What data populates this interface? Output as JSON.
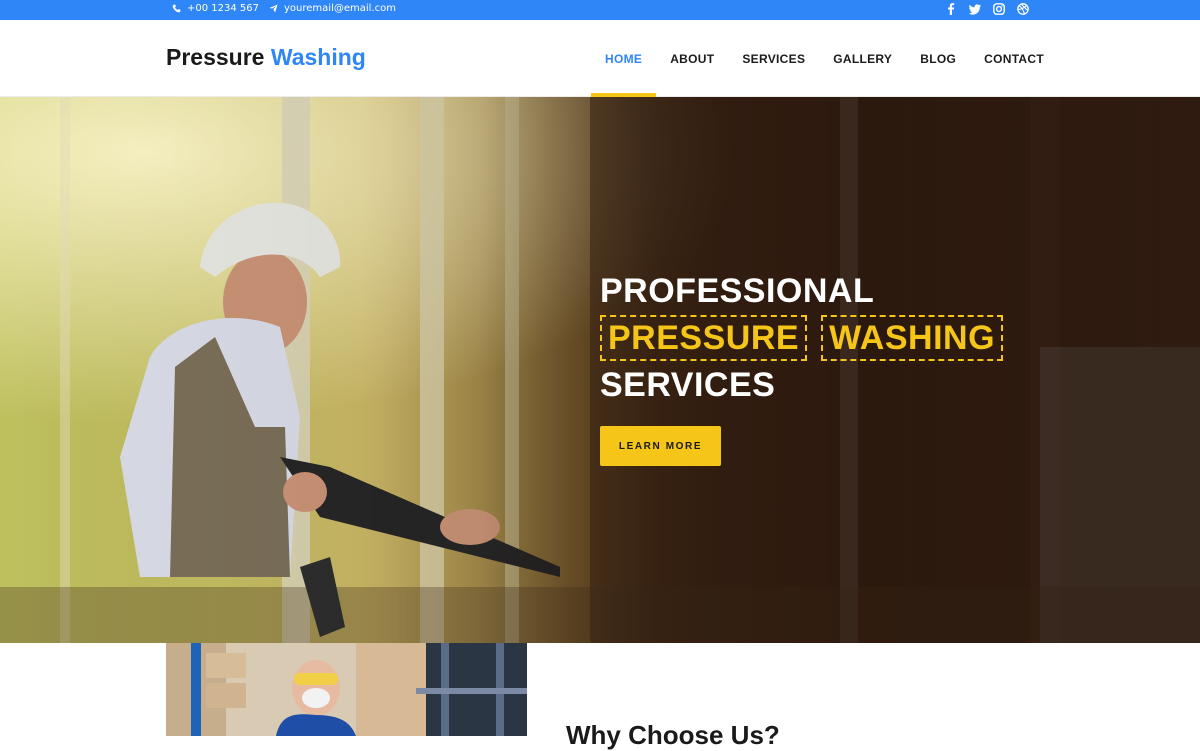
{
  "topbar": {
    "phone": "+00 1234 567",
    "email": "youremail@email.com",
    "icons": [
      "phone-icon",
      "paper-plane-icon"
    ],
    "social": [
      "facebook-icon",
      "twitter-icon",
      "instagram-icon",
      "dribbble-icon"
    ]
  },
  "brand": {
    "part1": "Pressure",
    "part2": "Washing"
  },
  "nav": {
    "items": [
      {
        "label": "HOME",
        "active": true
      },
      {
        "label": "ABOUT",
        "active": false
      },
      {
        "label": "SERVICES",
        "active": false
      },
      {
        "label": "GALLERY",
        "active": false
      },
      {
        "label": "BLOG",
        "active": false
      },
      {
        "label": "CONTACT",
        "active": false
      }
    ]
  },
  "hero": {
    "line1": "PROFESSIONAL",
    "highlight1": "PRESSURE",
    "highlight2": "WASHING",
    "line3": "SERVICES",
    "button": "LEARN MORE"
  },
  "section": {
    "title": "Why Choose Us?"
  },
  "colors": {
    "primary": "#2f86f6",
    "accent": "#f5c518",
    "dark": "#1a1a1a"
  }
}
